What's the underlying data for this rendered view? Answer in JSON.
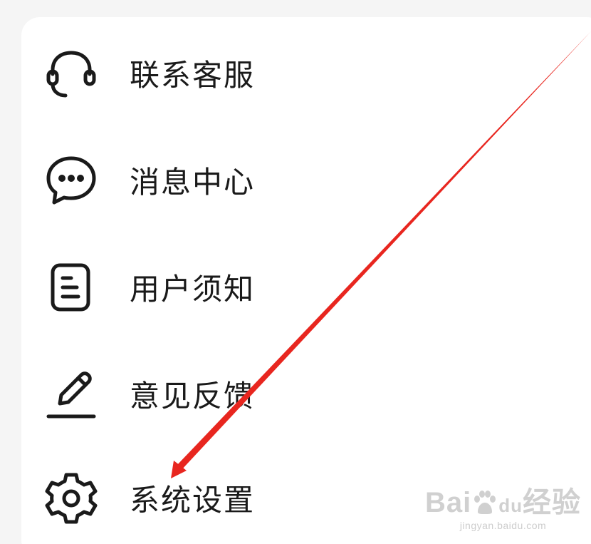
{
  "menu": {
    "items": [
      {
        "label": "联系客服",
        "icon": "headset-icon"
      },
      {
        "label": "消息中心",
        "icon": "chat-bubble-icon"
      },
      {
        "label": "用户须知",
        "icon": "document-icon"
      },
      {
        "label": "意见反馈",
        "icon": "pencil-icon"
      },
      {
        "label": "系统设置",
        "icon": "gear-icon"
      }
    ]
  },
  "watermark": {
    "logo_prefix": "Bai",
    "logo_du": "du",
    "logo_suffix": "经验",
    "url": "jingyan.baidu.com"
  },
  "colors": {
    "arrow": "#e8261f",
    "text": "#1a1a1a",
    "icon": "#1a1a1a",
    "card": "#ffffff",
    "background": "#f5f5f5"
  }
}
